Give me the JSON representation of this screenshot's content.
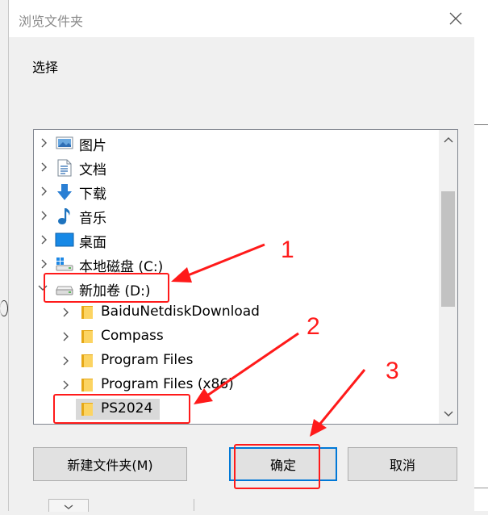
{
  "dialog": {
    "title": "浏览文件夹",
    "instruction": "选择"
  },
  "tree": {
    "items": [
      {
        "label": "图片",
        "icon": "pictures-icon",
        "expanded": false
      },
      {
        "label": "文档",
        "icon": "documents-icon",
        "expanded": false
      },
      {
        "label": "下载",
        "icon": "downloads-icon",
        "expanded": false
      },
      {
        "label": "音乐",
        "icon": "music-icon",
        "expanded": false
      },
      {
        "label": "桌面",
        "icon": "desktop-icon",
        "expanded": false
      },
      {
        "label": "本地磁盘 (C:)",
        "icon": "windows-drive-icon",
        "expanded": false
      },
      {
        "label": "新加卷 (D:)",
        "icon": "drive-icon",
        "expanded": true
      },
      {
        "label": "BaiduNetdiskDownload",
        "icon": "folder-icon",
        "expanded": false
      },
      {
        "label": "Compass",
        "icon": "folder-icon",
        "expanded": false
      },
      {
        "label": "Program Files",
        "icon": "folder-icon",
        "expanded": false
      },
      {
        "label": "Program Files (x86)",
        "icon": "folder-icon",
        "expanded": false
      },
      {
        "label": "PS2024",
        "icon": "folder-icon",
        "selected": true
      }
    ]
  },
  "buttons": {
    "new_folder": "新建文件夹(M)",
    "ok": "确定",
    "cancel": "取消"
  },
  "annotations": {
    "n1": "1",
    "n2": "2",
    "n3": "3"
  },
  "colors": {
    "annotation": "#ff1a1a",
    "selection": "#d9d9d9",
    "focus": "#0078d7"
  }
}
